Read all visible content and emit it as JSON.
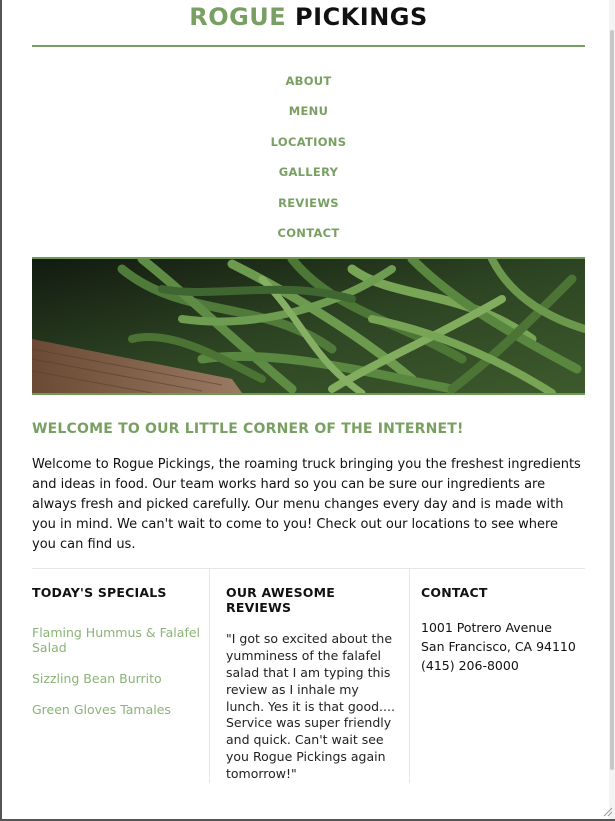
{
  "header": {
    "brand_green": "ROGUE",
    "brand_dark": "PICKINGS"
  },
  "nav": {
    "items": [
      {
        "label": "ABOUT"
      },
      {
        "label": "MENU"
      },
      {
        "label": "LOCATIONS"
      },
      {
        "label": "GALLERY"
      },
      {
        "label": "REVIEWS"
      },
      {
        "label": "CONTACT"
      }
    ]
  },
  "hero": {
    "image": "green-beans-photo"
  },
  "welcome": {
    "heading": "WELCOME TO OUR LITTLE CORNER OF THE INTERNET!",
    "body": "Welcome to Rogue Pickings, the roaming truck bringing you the freshest ingredients and ideas in food. Our team works hard so you can be sure our ingredients are always fresh and picked carefully. Our menu changes every day and is made with you in mind. We can't wait to come to you! Check out our locations to see where you can find us."
  },
  "specials": {
    "heading": "TODAY'S SPECIALS",
    "items": [
      {
        "label": "Flaming Hummus & Falafel Salad"
      },
      {
        "label": "Sizzling Bean Burrito"
      },
      {
        "label": "Green Gloves Tamales"
      }
    ]
  },
  "reviews": {
    "heading": "OUR AWESOME REVIEWS",
    "quote": "\"I got so excited about the yumminess of the falafel salad that I am typing this review as I inhale my lunch. Yes it is that good.... Service was super friendly and quick. Can't wait see you Rogue Pickings again tomorrow!\""
  },
  "contact": {
    "heading": "CONTACT",
    "street": "1001 Potrero Avenue",
    "city": "San Francisco, CA 94110",
    "phone": "(415) 206-8000"
  },
  "colors": {
    "accent": "#79a062",
    "text": "#111111"
  }
}
